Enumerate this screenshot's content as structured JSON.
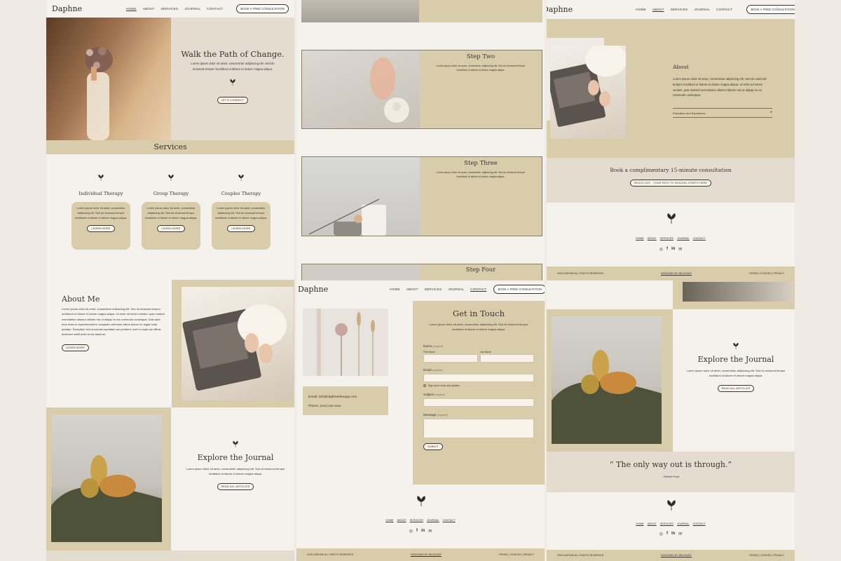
{
  "brand": "Daphne",
  "nav": {
    "home": "HOME",
    "about": "ABOUT",
    "services": "SERVICES",
    "journal": "JOURNAL",
    "contact": "CONTACT",
    "cta": "BOOK A FREE CONSULTATION"
  },
  "hero": {
    "title": "Walk the Path of Change.",
    "body": "Lorem ipsum dolor sit amet, consectetur adipiscing elit. Sed do eiusmod tempor incididunt ut labore et dolore magna aliqua.",
    "button": "LET'S CONNECT"
  },
  "services": {
    "heading": "Services",
    "items": [
      {
        "title": "Individual Therapy",
        "body": "Lorem ipsum dolor sit amet, consectetur adipiscing elit. Sed do eiusmod tempor incididunt ut labore et dolore magna aliqua.",
        "button": "LEARN MORE"
      },
      {
        "title": "Group Therapy",
        "body": "Lorem ipsum dolor sit amet, consectetur adipiscing elit. Sed do eiusmod tempor incididunt ut labore et dolore magna aliqua.",
        "button": "LEARN MORE"
      },
      {
        "title": "Couples Therapy",
        "body": "Lorem ipsum dolor sit amet, consectetur adipiscing elit. Sed do eiusmod tempor incididunt ut labore et dolore magna aliqua.",
        "button": "LEARN MORE"
      }
    ]
  },
  "about_me": {
    "title": "About Me",
    "body": "Lorem ipsum dolor sit amet, consectetur adipiscing elit. Sed do eiusmod tempor incididunt ut labore et dolore magna aliqua. Ut enim ad minim veniam, quis nostrud exercitation ullamco laboris nisi ut aliquip ex ea commodo consequat. Duis aute irure dolor in reprehenderit in voluptate velit esse cillum dolore eu fugiat nulla pariatur. Excepteur sint occaecat cupidatat non proident, sunt in culpa qui officia deserunt mollit anim id est laborum.",
    "button": "LEARN MORE"
  },
  "journal": {
    "title": "Explore the Journal",
    "body": "Lorem ipsum dolor sit amet, consectetur adipiscing elit. Sed do eiusmod tempor incididunt ut labore et dolore magna aliqua.",
    "button": "READ ALL ARTICLES"
  },
  "steps": [
    {
      "title": "Step Two",
      "body": "Lorem ipsum dolor sit amet, consectetur adipiscing elit. Sed do eiusmod tempor incididunt ut labore et dolore magna aliqua."
    },
    {
      "title": "Step Three",
      "body": "Lorem ipsum dolor sit amet, consectetur adipiscing elit. Sed do eiusmod tempor incididunt ut labore et dolore magna aliqua."
    },
    {
      "title": "Step Four",
      "body": ""
    }
  ],
  "contact": {
    "title": "Get in Touch",
    "body": "Lorem ipsum dolor sit amet, consectetur adipiscing elit. Sed do eiusmod tempor incididunt ut labore et dolore magna aliqua.",
    "email": "Email: info@daphnetherapy.com",
    "phone": "Phone: (xxx) xxx-xxxx",
    "name_label": "Name",
    "required": "(required)",
    "first_name": "First Name",
    "last_name": "Last Name",
    "email_label": "Email",
    "signup": "Sign up for news and updates.",
    "subject_label": "Subject",
    "message_label": "Message",
    "submit": "SUBMIT"
  },
  "about_page": {
    "title": "About",
    "body": "Lorem ipsum dolor sit amet, consectetur adipiscing elit. Sed do eiusmod tempor incididunt ut labore et dolore magna aliqua. Ut enim ad minim veniam, quis nostrud exercitation ullamco laboris nisi ut aliquip ex ea commodo consequat.",
    "accordion": "Education and Experience",
    "accordion_icon": "+"
  },
  "consult": {
    "title": "Book a complimentary 15-minute consultation",
    "button": "REACH OUT - YOUR PATH TO HEALING STARTS HERE"
  },
  "quote": {
    "text": "“ The only way out is through.”",
    "author": "- Robert Frost"
  },
  "footer": {
    "copyright": "2025 DAPHNE ALL RIGHTS RESERVED",
    "designed": "DESIGNED BY BELVEART",
    "legal": "TERMS | COOKIES | PRIVACY",
    "social_icons": [
      "instagram-icon",
      "facebook-icon",
      "linkedin-icon",
      "mail-icon"
    ]
  },
  "colors": {
    "tan": "#d9ccaa",
    "beige": "#e4ddcf",
    "cream": "#f5f1ec",
    "ink": "#3a3430"
  }
}
